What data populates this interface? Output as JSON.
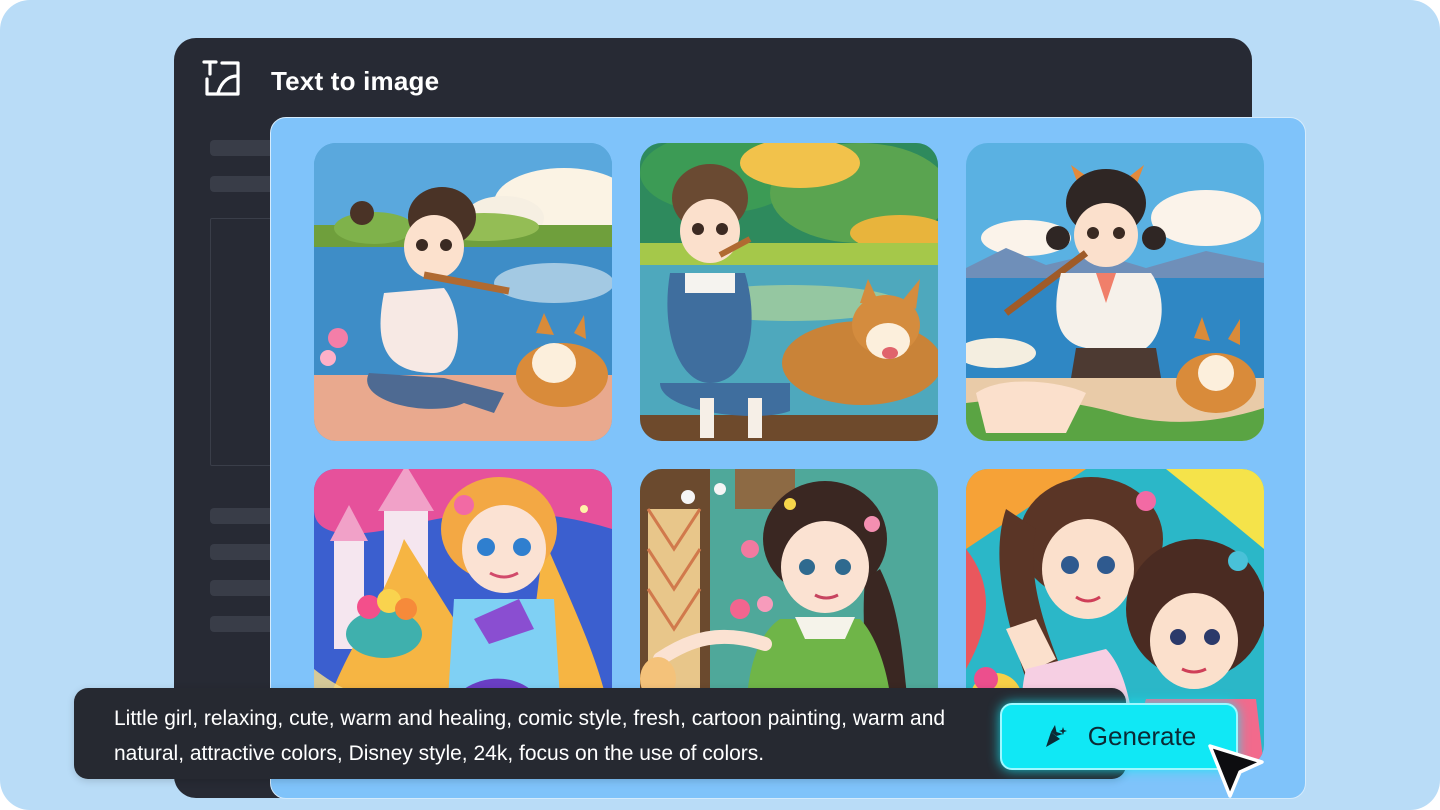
{
  "app": {
    "title": "Text to image",
    "icon": "text-to-image-icon"
  },
  "gallery": {
    "images": [
      {
        "name": "girl-flute-lake-corgi"
      },
      {
        "name": "girl-overalls-corgi-pond"
      },
      {
        "name": "girl-cat-ears-flute-corgi"
      },
      {
        "name": "princess-castle-plush"
      },
      {
        "name": "girl-green-dress-flowers"
      },
      {
        "name": "two-girls-colorful"
      }
    ]
  },
  "prompt": {
    "text": "Little girl, relaxing, cute, warm and healing, comic style, fresh, cartoon painting, warm and natural, attractive colors, Disney style, 24k, focus on the use of colors."
  },
  "generate": {
    "label": "Generate",
    "icon": "sparkle-icon",
    "color": "#10e8f5"
  },
  "colors": {
    "background": "#b9dcf7",
    "window": "#272a34",
    "gallery": "#7fc3fa",
    "prompt_bar": "#262931"
  }
}
